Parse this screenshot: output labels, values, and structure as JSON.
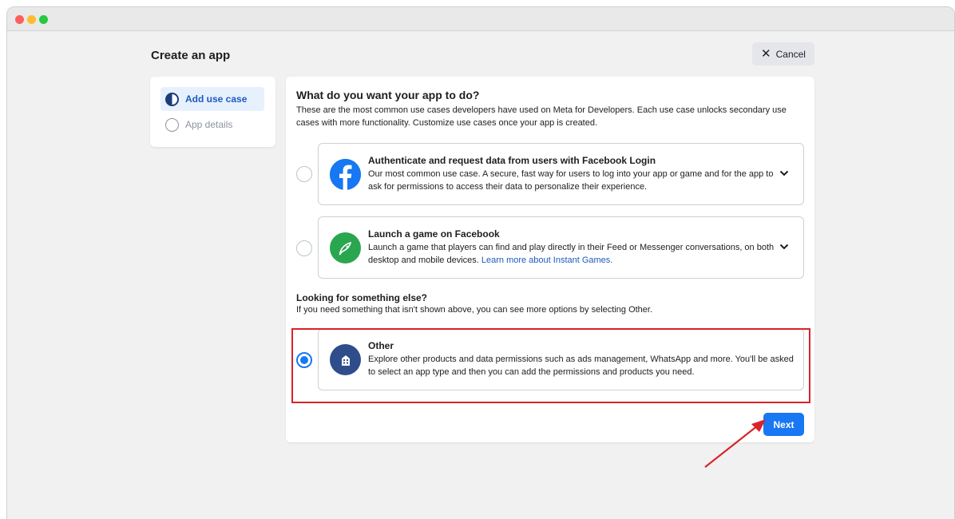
{
  "header": {
    "title": "Create an app",
    "cancel_label": "Cancel"
  },
  "steps": [
    {
      "label": "Add use case",
      "state": "active"
    },
    {
      "label": "App details",
      "state": "inactive"
    }
  ],
  "main": {
    "question_title": "What do you want your app to do?",
    "question_desc": "These are the most common use cases developers have used on Meta for Developers. Each use case unlocks secondary use cases with more functionality. Customize use cases once your app is created.",
    "options": [
      {
        "title": "Authenticate and request data from users with Facebook Login",
        "desc": "Our most common use case. A secure, fast way for users to log into your app or game and for the app to ask for permissions to access their data to personalize their experience.",
        "icon": "facebook-logo-icon",
        "selected": false
      },
      {
        "title": "Launch a game on Facebook",
        "desc": "Launch a game that players can find and play directly in their Feed or Messenger conversations, on both desktop and mobile devices.",
        "link": "Learn more about Instant Games.",
        "icon": "game-controller-icon",
        "selected": false
      }
    ],
    "looking_title": "Looking for something else?",
    "looking_desc": "If you need something that isn't shown above, you can see more options by selecting Other.",
    "other": {
      "title": "Other",
      "desc": "Explore other products and data permissions such as ads management, WhatsApp and more. You'll be asked to select an app type and then you can add the permissions and products you need.",
      "icon": "building-icon",
      "selected": true
    },
    "next_label": "Next"
  },
  "colors": {
    "accent": "#1877f2",
    "highlight": "#d8232a",
    "facebook": "#1877f2",
    "game_green": "#2aa64f",
    "other_icon_bg": "#2f4d8a"
  }
}
